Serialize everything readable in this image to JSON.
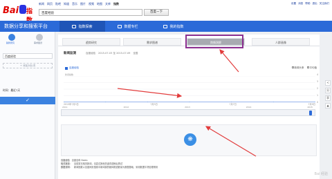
{
  "header": {
    "logo_text": "Bai",
    "logo_suffix": "指数",
    "top_nav": [
      "新闻",
      "网页",
      "贴吧",
      "知道",
      "音乐",
      "图片",
      "视频",
      "地图",
      "文库",
      "百度一下",
      "指数"
    ],
    "search_value": "百度经验",
    "search_button": "百度一下",
    "user_links": [
      "设置",
      "消息",
      "帮助",
      "|",
      "退出",
      "关注我们"
    ]
  },
  "bluebar": {
    "brand": "数据分享和搜索平台",
    "tabs": [
      {
        "label": "指数探索",
        "active": true
      },
      {
        "label": "数据专栏",
        "active": false
      },
      {
        "label": "我的指数",
        "active": false
      }
    ]
  },
  "sidebar": {
    "mode_a": "趋势研究",
    "mode_b": "需求图谱",
    "keyword": "百度经验",
    "add_compare": "+ 添加对比词",
    "time_label": "时间：最近7天",
    "confirm": "✓"
  },
  "main": {
    "subtabs": [
      "趋势研究",
      "需求图谱",
      "舆情洞察",
      "人群画像"
    ],
    "section_title": "新闻监测",
    "meta": [
      "百度经验",
      "2015-07-03 至 2015-07-09",
      "全国"
    ],
    "legend_series": "百度经验",
    "legend_right": [
      "新闻头条",
      "平均值"
    ],
    "chart_label": "新闻指数",
    "y_ticks": [
      "4",
      "3",
      "2",
      "1",
      "0"
    ],
    "x_ticks": [
      "2015年7月3日",
      "7月5日",
      "7月7日",
      "7月9日"
    ],
    "range_ticks": [
      "2011",
      "2012",
      "2013",
      "2014",
      "2015"
    ],
    "notes": [
      {
        "k": "百度经验",
        "v": "百度百科 Baidu"
      },
      {
        "k": "相关报道：",
        "v": "目前暂无相关新闻，请尝试其他关键词或稍后再试"
      },
      {
        "k": "数据说明：",
        "v": "新闻指数以百度网页搜索中新闻源的媒体报道数量为数据基础，采用数据平滑处理得到"
      }
    ]
  },
  "chart_data": {
    "type": "line",
    "x": [
      "2015-07-03",
      "2015-07-04",
      "2015-07-05",
      "2015-07-06",
      "2015-07-07",
      "2015-07-08",
      "2015-07-09"
    ],
    "series": [
      {
        "name": "百度经验",
        "values": [
          0,
          0,
          0,
          0,
          0,
          0,
          0
        ]
      }
    ],
    "ylim": [
      0,
      4
    ],
    "ylabel": "",
    "xlabel": "",
    "title": "",
    "color": "#2b6ad8"
  },
  "right_bar": [
    "<",
    "分",
    "享",
    "▲"
  ],
  "watermark": "Bai 经验"
}
